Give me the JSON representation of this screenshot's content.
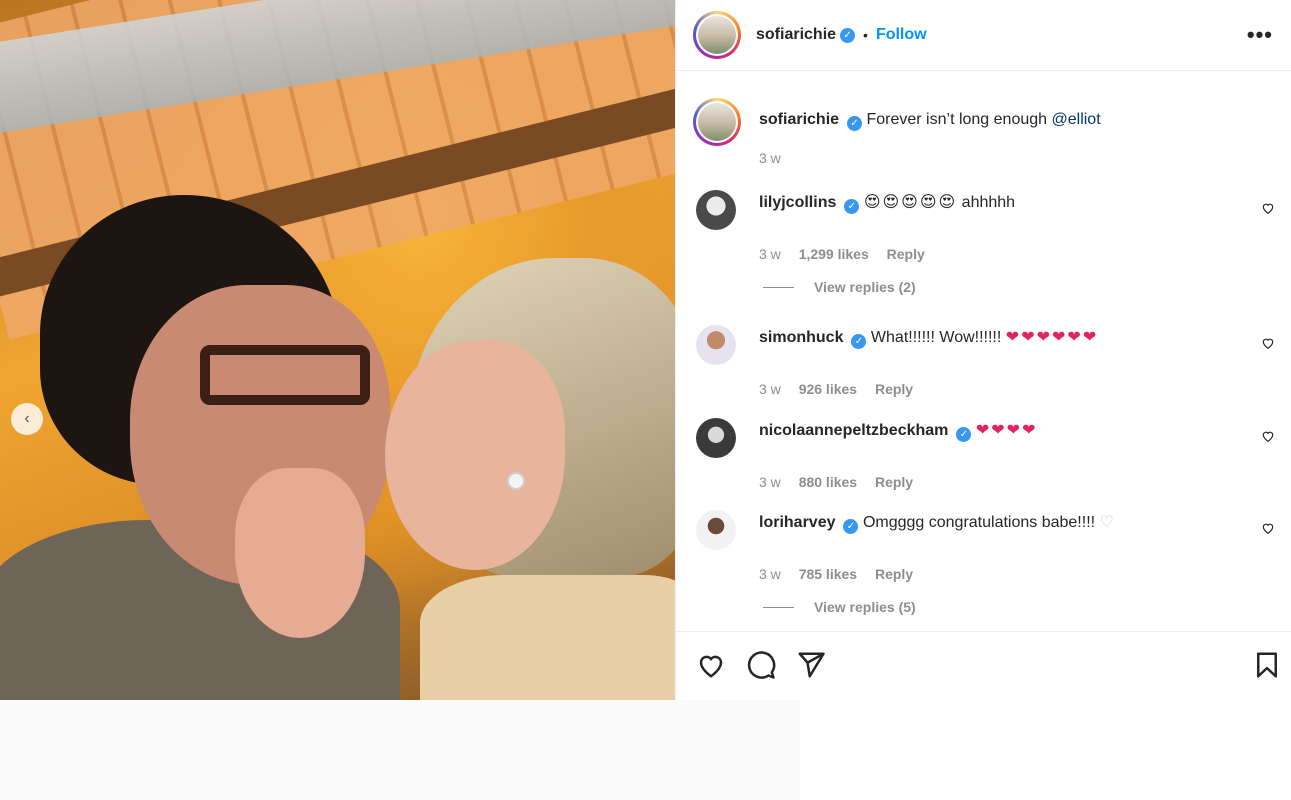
{
  "post": {
    "author": "sofiarichie",
    "follow_label": "Follow",
    "separator": "•",
    "more_label": "•••"
  },
  "caption": {
    "username": "sofiarichie",
    "text": "Forever isn’t long enough",
    "mention": "@elliot",
    "time": "3 w"
  },
  "comments": [
    {
      "username": "lilyjcollins",
      "emoji": "😍😍😍😍😍",
      "text": "ahhhhh",
      "time": "3 w",
      "likes": "1,299 likes",
      "reply": "Reply"
    },
    {
      "username": "simonhuck",
      "text": "What!!!!!! Wow!!!!!!",
      "emoji": "❤❤❤❤❤❤",
      "time": "3 w",
      "likes": "926 likes",
      "reply": "Reply"
    },
    {
      "username": "nicolaannepeltzbeckham",
      "emoji": "❤❤❤❤",
      "time": "3 w",
      "likes": "880 likes",
      "reply": "Reply"
    },
    {
      "username": "loriharvey",
      "text": "Omgggg congratulations babe!!!!",
      "emoji": "♡",
      "time": "3 w",
      "likes": "785 likes",
      "reply": "Reply"
    }
  ],
  "view_replies": [
    "View replies (2)",
    "View replies (5)"
  ],
  "carousel": {
    "prev_icon": "‹"
  },
  "colors": {
    "accent": "#0095f6",
    "verified": "#3897f0",
    "heart": "#e0245e",
    "muted": "#8e8e8e"
  },
  "icons": [
    "verified-badge-icon",
    "more-options-icon",
    "heart-icon",
    "comment-icon",
    "share-icon",
    "bookmark-icon",
    "chevron-left-icon"
  ]
}
